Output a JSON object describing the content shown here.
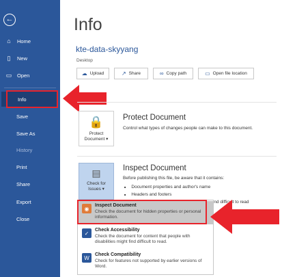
{
  "sidebar": {
    "back_icon": "arrow-left-icon",
    "items": [
      {
        "label": "Home",
        "icon": "home-icon"
      },
      {
        "label": "New",
        "icon": "new-doc-icon"
      },
      {
        "label": "Open",
        "icon": "folder-icon"
      },
      {
        "label": "Info"
      },
      {
        "label": "Save"
      },
      {
        "label": "Save As"
      },
      {
        "label": "History"
      },
      {
        "label": "Print"
      },
      {
        "label": "Share"
      },
      {
        "label": "Export"
      },
      {
        "label": "Close"
      }
    ]
  },
  "main": {
    "title": "Info",
    "document_name": "kte-data-skyyang",
    "document_location": "Desktop",
    "buttons": [
      {
        "label": "Upload",
        "icon": "upload-icon"
      },
      {
        "label": "Share",
        "icon": "share-icon"
      },
      {
        "label": "Copy path",
        "icon": "link-icon"
      },
      {
        "label": "Open file location",
        "icon": "folder-icon"
      }
    ],
    "protect": {
      "button_line1": "Protect",
      "button_line2": "Document ▾",
      "title": "Protect Document",
      "description": "Control what types of changes people can make to this document."
    },
    "inspect": {
      "button_line1": "Check for",
      "button_line2": "Issues ▾",
      "title": "Inspect Document",
      "description": "Before publishing this file, be aware that it contains:",
      "bullets": [
        "Document properties and author's name",
        "Headers and footers"
      ],
      "partial_text": "s find difficult to read"
    },
    "dropdown": [
      {
        "title": "Inspect Document",
        "description": "Check the document for hidden properties or personal information.",
        "icon": "inspect-document-icon"
      },
      {
        "title": "Check Accessibility",
        "description": "Check the document for content that people with disabilities might find difficult to read.",
        "icon": "accessibility-icon"
      },
      {
        "title": "Check Compatibility",
        "description": "Check for features not supported by earlier versions of Word.",
        "icon": "compatibility-icon"
      }
    ]
  },
  "colors": {
    "sidebar": "#2b579a",
    "selected_nav": "#1e3f74",
    "annotation_red": "#e8232b",
    "link_blue": "#2b579a"
  }
}
